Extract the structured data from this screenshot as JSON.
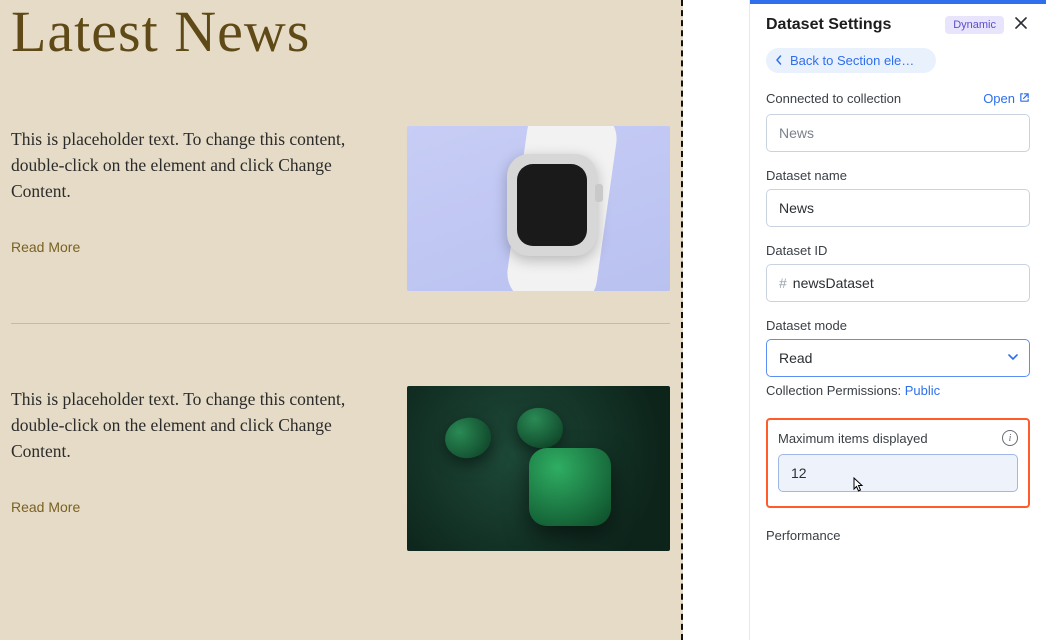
{
  "canvas": {
    "title": "Latest News",
    "items": [
      {
        "desc": "This is placeholder text. To change this content, double-click on the element and click Change Content.",
        "more": "Read More"
      },
      {
        "desc": "This is placeholder text. To change this content, double-click on the element and click Change Content.",
        "more": "Read More"
      }
    ]
  },
  "panel": {
    "title": "Dataset Settings",
    "badge": "Dynamic",
    "back": "Back to Section elem…",
    "connected_label": "Connected to collection",
    "open": "Open",
    "collection_placeholder": "News",
    "dataset_name_label": "Dataset name",
    "dataset_name_value": "News",
    "dataset_id_label": "Dataset ID",
    "dataset_id_prefix": "#",
    "dataset_id_value": "newsDataset",
    "dataset_mode_label": "Dataset mode",
    "dataset_mode_value": "Read",
    "perm_label": "Collection Permissions: ",
    "perm_value": "Public",
    "max_label": "Maximum items displayed",
    "max_value": "12",
    "performance_label": "Performance"
  }
}
